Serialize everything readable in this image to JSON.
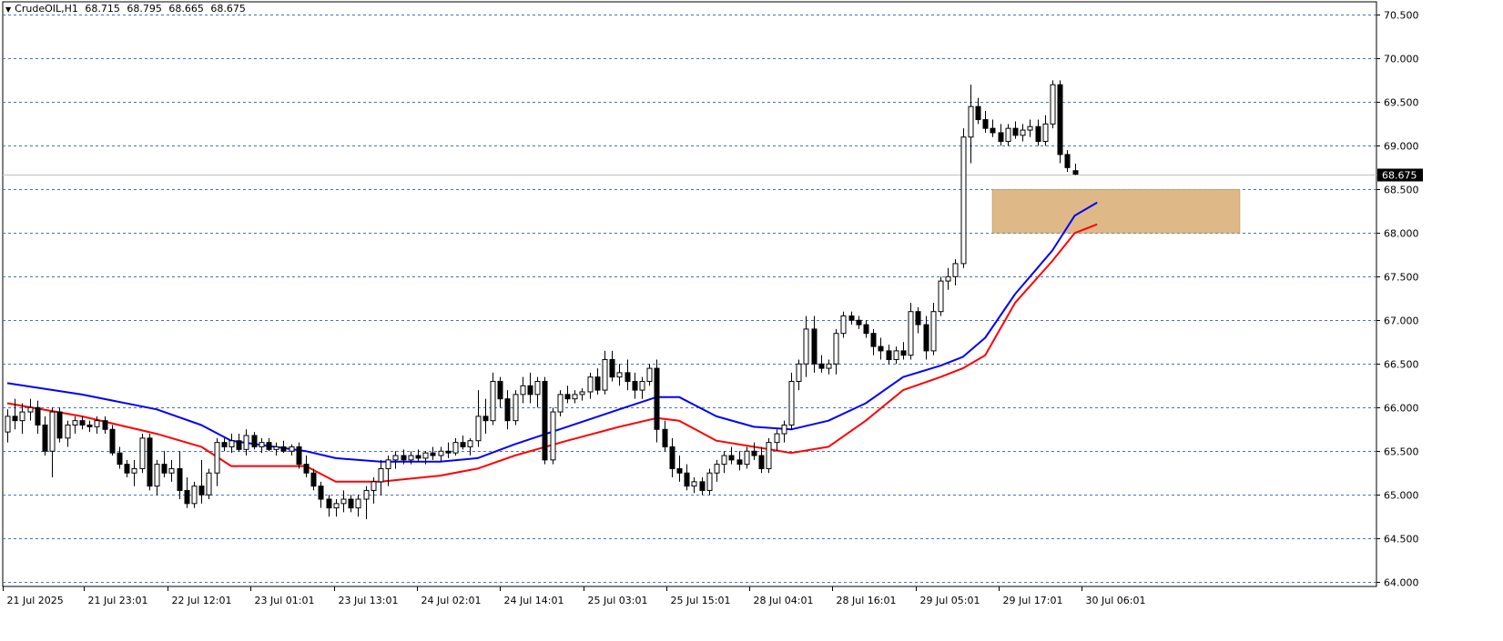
{
  "header": {
    "symbol": "CrudeOIL,H1",
    "open": "68.715",
    "high": "68.795",
    "low": "68.665",
    "close": "68.675"
  },
  "colors": {
    "up_candle": "#ffffff",
    "down_candle": "#000000",
    "grid": "#4a6fbf",
    "ma_fast": "#0000ff",
    "ma_slow": "#ff0000",
    "zone": "#deb887"
  },
  "chart_data": {
    "type": "candlestick",
    "title": "CrudeOIL,H1",
    "ylim": [
      63.95,
      70.65
    ],
    "y_ticks": [
      "64.000",
      "64.500",
      "65.000",
      "65.500",
      "66.000",
      "66.500",
      "67.000",
      "67.500",
      "68.000",
      "68.500",
      "69.000",
      "69.500",
      "70.000",
      "70.500"
    ],
    "current_price": "68.675",
    "x_labels": [
      "21 Jul 2025",
      "21 Jul 23:01",
      "22 Jul 12:01",
      "23 Jul 01:01",
      "23 Jul 13:01",
      "24 Jul 02:01",
      "24 Jul 14:01",
      "25 Jul 03:01",
      "25 Jul 15:01",
      "28 Jul 04:01",
      "28 Jul 16:01",
      "29 Jul 05:01",
      "29 Jul 17:01",
      "30 Jul 06:01"
    ],
    "candles": [
      [
        65.72,
        65.98,
        65.6,
        65.9
      ],
      [
        65.9,
        66.1,
        65.75,
        65.85
      ],
      [
        65.85,
        66.05,
        65.7,
        65.95
      ],
      [
        65.95,
        66.1,
        65.85,
        66.0
      ],
      [
        66.0,
        66.08,
        65.7,
        65.8
      ],
      [
        65.8,
        65.9,
        65.45,
        65.5
      ],
      [
        65.5,
        66.0,
        65.2,
        65.95
      ],
      [
        65.95,
        66.0,
        65.6,
        65.65
      ],
      [
        65.65,
        65.85,
        65.55,
        65.8
      ],
      [
        65.8,
        65.9,
        65.7,
        65.85
      ],
      [
        65.85,
        65.9,
        65.75,
        65.8
      ],
      [
        65.8,
        65.85,
        65.72,
        65.78
      ],
      [
        65.78,
        65.9,
        65.7,
        65.85
      ],
      [
        65.85,
        65.9,
        65.7,
        65.75
      ],
      [
        65.75,
        65.8,
        65.45,
        65.48
      ],
      [
        65.48,
        65.55,
        65.3,
        65.35
      ],
      [
        65.35,
        65.4,
        65.2,
        65.25
      ],
      [
        65.25,
        65.4,
        65.1,
        65.3
      ],
      [
        65.3,
        65.7,
        65.25,
        65.65
      ],
      [
        65.65,
        65.7,
        65.05,
        65.1
      ],
      [
        65.1,
        65.4,
        65.0,
        65.35
      ],
      [
        65.35,
        65.5,
        65.2,
        65.25
      ],
      [
        65.25,
        65.4,
        65.15,
        65.3
      ],
      [
        65.3,
        65.5,
        64.95,
        65.05
      ],
      [
        65.05,
        65.2,
        64.85,
        64.9
      ],
      [
        64.9,
        65.15,
        64.85,
        65.1
      ],
      [
        65.1,
        65.4,
        64.9,
        65.0
      ],
      [
        65.0,
        65.3,
        64.95,
        65.25
      ],
      [
        65.25,
        65.65,
        65.1,
        65.6
      ],
      [
        65.6,
        65.65,
        65.5,
        65.55
      ],
      [
        65.55,
        65.7,
        65.48,
        65.62
      ],
      [
        65.62,
        65.7,
        65.5,
        65.52
      ],
      [
        65.52,
        65.75,
        65.45,
        65.68
      ],
      [
        65.68,
        65.72,
        65.52,
        65.55
      ],
      [
        65.55,
        65.65,
        65.48,
        65.6
      ],
      [
        65.6,
        65.65,
        65.5,
        65.52
      ],
      [
        65.52,
        65.6,
        65.45,
        65.55
      ],
      [
        65.55,
        65.62,
        65.48,
        65.5
      ],
      [
        65.5,
        65.58,
        65.45,
        65.55
      ],
      [
        65.55,
        65.6,
        65.3,
        65.35
      ],
      [
        65.35,
        65.45,
        65.2,
        65.25
      ],
      [
        65.25,
        65.3,
        65.05,
        65.1
      ],
      [
        65.1,
        65.15,
        64.85,
        64.95
      ],
      [
        64.95,
        65.0,
        64.75,
        64.85
      ],
      [
        64.85,
        64.95,
        64.75,
        64.9
      ],
      [
        64.9,
        65.05,
        64.8,
        64.95
      ],
      [
        64.95,
        65.0,
        64.8,
        64.85
      ],
      [
        64.85,
        65.0,
        64.75,
        64.95
      ],
      [
        64.95,
        65.1,
        64.72,
        65.05
      ],
      [
        65.05,
        65.2,
        64.9,
        65.15
      ],
      [
        65.15,
        65.4,
        65.0,
        65.3
      ],
      [
        65.3,
        65.45,
        65.1,
        65.4
      ],
      [
        65.4,
        65.5,
        65.3,
        65.45
      ],
      [
        65.45,
        65.52,
        65.35,
        65.4
      ],
      [
        65.4,
        65.5,
        65.35,
        65.45
      ],
      [
        65.45,
        65.52,
        65.38,
        65.42
      ],
      [
        65.42,
        65.5,
        65.35,
        65.48
      ],
      [
        65.48,
        65.55,
        65.4,
        65.45
      ],
      [
        65.45,
        65.55,
        65.38,
        65.5
      ],
      [
        65.5,
        65.6,
        65.42,
        65.48
      ],
      [
        65.48,
        65.65,
        65.45,
        65.6
      ],
      [
        65.6,
        65.68,
        65.52,
        65.55
      ],
      [
        65.55,
        65.65,
        65.45,
        65.62
      ],
      [
        65.62,
        66.2,
        65.55,
        65.9
      ],
      [
        65.9,
        66.1,
        65.7,
        65.85
      ],
      [
        65.85,
        66.4,
        65.8,
        66.3
      ],
      [
        66.3,
        66.35,
        66.0,
        66.1
      ],
      [
        66.1,
        66.2,
        65.75,
        65.85
      ],
      [
        65.85,
        66.2,
        65.8,
        66.15
      ],
      [
        66.15,
        66.35,
        66.05,
        66.25
      ],
      [
        66.25,
        66.4,
        66.05,
        66.15
      ],
      [
        66.15,
        66.35,
        66.0,
        66.3
      ],
      [
        66.3,
        66.35,
        65.35,
        65.4
      ],
      [
        65.4,
        66.0,
        65.35,
        65.95
      ],
      [
        65.95,
        66.2,
        65.9,
        66.15
      ],
      [
        66.15,
        66.25,
        66.05,
        66.1
      ],
      [
        66.1,
        66.2,
        66.05,
        66.15
      ],
      [
        66.15,
        66.22,
        66.08,
        66.18
      ],
      [
        66.18,
        66.4,
        66.1,
        66.35
      ],
      [
        66.35,
        66.45,
        66.15,
        66.2
      ],
      [
        66.2,
        66.65,
        66.15,
        66.55
      ],
      [
        66.55,
        66.65,
        66.3,
        66.35
      ],
      [
        66.35,
        66.5,
        66.25,
        66.4
      ],
      [
        66.4,
        66.55,
        66.2,
        66.3
      ],
      [
        66.3,
        66.4,
        66.1,
        66.2
      ],
      [
        66.2,
        66.35,
        66.1,
        66.3
      ],
      [
        66.3,
        66.5,
        66.25,
        66.45
      ],
      [
        66.45,
        66.55,
        65.6,
        65.75
      ],
      [
        65.75,
        65.85,
        65.5,
        65.55
      ],
      [
        65.55,
        65.65,
        65.2,
        65.3
      ],
      [
        65.3,
        65.45,
        65.15,
        65.25
      ],
      [
        65.25,
        65.35,
        65.05,
        65.1
      ],
      [
        65.1,
        65.2,
        65.02,
        65.15
      ],
      [
        65.15,
        65.2,
        65.0,
        65.05
      ],
      [
        65.05,
        65.3,
        65.0,
        65.25
      ],
      [
        65.25,
        65.4,
        65.15,
        65.35
      ],
      [
        65.35,
        65.5,
        65.25,
        65.45
      ],
      [
        65.45,
        65.55,
        65.35,
        65.4
      ],
      [
        65.4,
        65.5,
        65.28,
        65.35
      ],
      [
        65.35,
        65.55,
        65.3,
        65.5
      ],
      [
        65.5,
        65.6,
        65.4,
        65.45
      ],
      [
        65.45,
        65.55,
        65.25,
        65.3
      ],
      [
        65.3,
        65.65,
        65.25,
        65.6
      ],
      [
        65.6,
        65.75,
        65.5,
        65.7
      ],
      [
        65.7,
        65.85,
        65.6,
        65.8
      ],
      [
        65.8,
        66.4,
        65.75,
        66.3
      ],
      [
        66.3,
        66.55,
        66.2,
        66.5
      ],
      [
        66.5,
        67.05,
        66.35,
        66.9
      ],
      [
        66.9,
        67.05,
        66.4,
        66.5
      ],
      [
        66.5,
        66.6,
        66.4,
        66.45
      ],
      [
        66.45,
        66.55,
        66.38,
        66.5
      ],
      [
        66.5,
        66.9,
        66.38,
        66.85
      ],
      [
        66.85,
        67.1,
        66.8,
        67.05
      ],
      [
        67.05,
        67.1,
        66.95,
        67.0
      ],
      [
        67.0,
        67.05,
        66.9,
        66.95
      ],
      [
        66.95,
        67.0,
        66.8,
        66.85
      ],
      [
        66.85,
        66.9,
        66.6,
        66.7
      ],
      [
        66.7,
        66.8,
        66.55,
        66.65
      ],
      [
        66.65,
        66.72,
        66.5,
        66.55
      ],
      [
        66.55,
        66.7,
        66.5,
        66.65
      ],
      [
        66.65,
        66.75,
        66.55,
        66.6
      ],
      [
        66.6,
        67.2,
        66.55,
        67.1
      ],
      [
        67.1,
        67.15,
        66.85,
        66.95
      ],
      [
        66.95,
        67.05,
        66.55,
        66.65
      ],
      [
        66.65,
        67.2,
        66.6,
        67.1
      ],
      [
        67.1,
        67.5,
        67.05,
        67.45
      ],
      [
        67.45,
        67.6,
        67.35,
        67.5
      ],
      [
        67.5,
        67.7,
        67.4,
        67.65
      ],
      [
        67.65,
        69.2,
        67.6,
        69.1
      ],
      [
        69.1,
        69.7,
        68.8,
        69.45
      ],
      [
        69.45,
        69.55,
        69.25,
        69.3
      ],
      [
        69.3,
        69.4,
        69.15,
        69.2
      ],
      [
        69.2,
        69.3,
        69.1,
        69.15
      ],
      [
        69.15,
        69.25,
        69.0,
        69.05
      ],
      [
        69.05,
        69.25,
        69.0,
        69.2
      ],
      [
        69.2,
        69.28,
        69.08,
        69.12
      ],
      [
        69.12,
        69.25,
        69.05,
        69.18
      ],
      [
        69.18,
        69.3,
        69.1,
        69.22
      ],
      [
        69.22,
        69.3,
        69.0,
        69.05
      ],
      [
        69.05,
        69.35,
        69.0,
        69.25
      ],
      [
        69.25,
        69.75,
        69.2,
        69.7
      ],
      [
        69.7,
        69.75,
        68.8,
        68.9
      ],
      [
        68.9,
        68.95,
        68.7,
        68.75
      ],
      [
        68.715,
        68.795,
        68.665,
        68.675
      ]
    ],
    "series": [
      {
        "color": "#0000ff",
        "values": [
          [
            0,
            66.28
          ],
          [
            10,
            66.15
          ],
          [
            20,
            65.98
          ],
          [
            26,
            65.8
          ],
          [
            30,
            65.62
          ],
          [
            40,
            65.5
          ],
          [
            44,
            65.42
          ],
          [
            50,
            65.38
          ],
          [
            58,
            65.38
          ],
          [
            63,
            65.42
          ],
          [
            68,
            65.58
          ],
          [
            75,
            65.78
          ],
          [
            82,
            65.98
          ],
          [
            87,
            66.12
          ],
          [
            90,
            66.12
          ],
          [
            95,
            65.9
          ],
          [
            100,
            65.78
          ],
          [
            105,
            65.75
          ],
          [
            110,
            65.85
          ],
          [
            115,
            66.05
          ],
          [
            120,
            66.35
          ],
          [
            125,
            66.48
          ],
          [
            128,
            66.58
          ],
          [
            131,
            66.8
          ],
          [
            135,
            67.3
          ],
          [
            140,
            67.8
          ],
          [
            143,
            68.2
          ],
          [
            146,
            68.35
          ]
        ]
      },
      {
        "color": "#ff0000",
        "values": [
          [
            0,
            66.05
          ],
          [
            10,
            65.9
          ],
          [
            20,
            65.7
          ],
          [
            26,
            65.55
          ],
          [
            30,
            65.33
          ],
          [
            40,
            65.33
          ],
          [
            44,
            65.15
          ],
          [
            50,
            65.15
          ],
          [
            58,
            65.22
          ],
          [
            63,
            65.3
          ],
          [
            68,
            65.45
          ],
          [
            75,
            65.62
          ],
          [
            82,
            65.78
          ],
          [
            87,
            65.88
          ],
          [
            90,
            65.85
          ],
          [
            95,
            65.62
          ],
          [
            100,
            65.55
          ],
          [
            105,
            65.48
          ],
          [
            110,
            65.55
          ],
          [
            115,
            65.85
          ],
          [
            120,
            66.2
          ],
          [
            125,
            66.35
          ],
          [
            128,
            66.45
          ],
          [
            131,
            66.6
          ],
          [
            135,
            67.2
          ],
          [
            140,
            67.68
          ],
          [
            143,
            68.0
          ],
          [
            146,
            68.1
          ]
        ]
      }
    ],
    "zone": {
      "from": 68.0,
      "to": 68.5,
      "start_index": 130,
      "end_index": 152
    }
  }
}
